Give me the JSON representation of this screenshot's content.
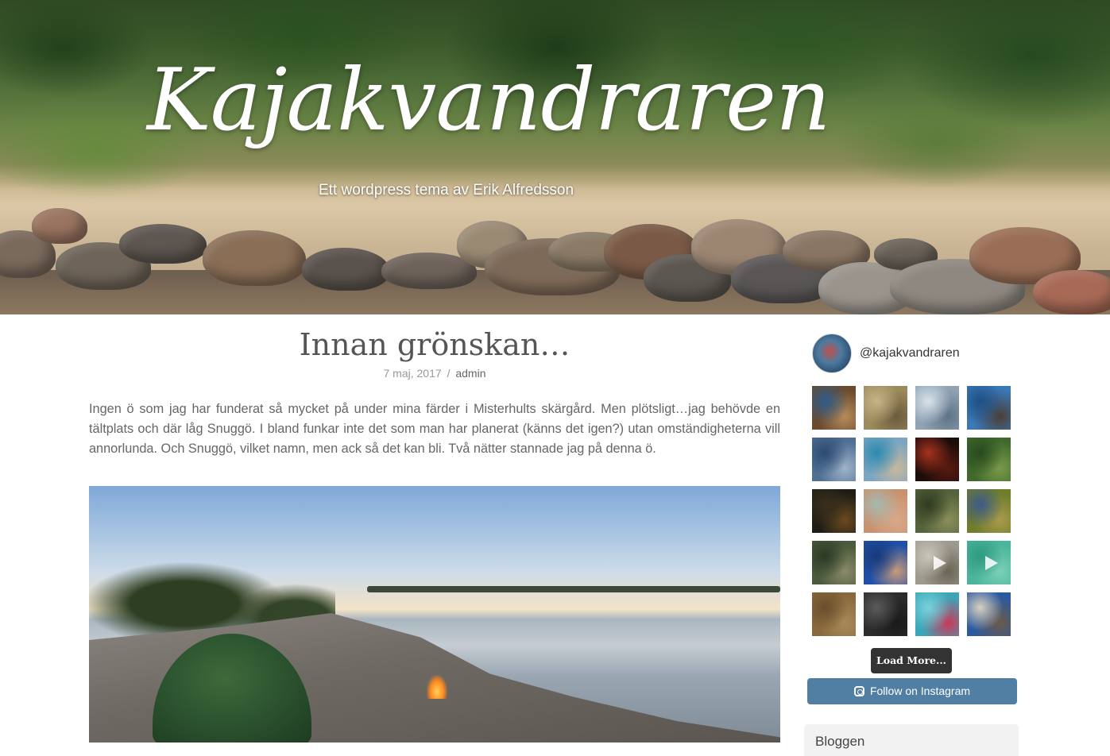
{
  "site": {
    "title": "Kajakvandraren",
    "tagline": "Ett wordpress tema av Erik Alfredsson"
  },
  "post": {
    "title": "Innan grönskan…",
    "date": "7 maj, 2017",
    "separator": "/",
    "author": "admin",
    "body": "Ingen ö som jag har funderat så mycket på under mina färder i Misterhults skärgård. Men plötsligt…jag behövde en tältplats och där låg Snuggö. I bland funkar inte det som man har planerat (känns det igen?) utan omständigheterna vill annorlunda. Och Snuggö, vilket namn, men ack så det kan bli. Två nätter stannade jag på denna ö."
  },
  "instagram": {
    "username": "@kajakvandraren",
    "load_more_label": "Load More...",
    "follow_label": "Follow on Instagram",
    "thumbs": [
      {
        "colors": [
          "#6b4a2e",
          "#2d5c8a",
          "#b58b5a"
        ],
        "video": false
      },
      {
        "colors": [
          "#9c8a5c",
          "#c6b487",
          "#6a5b3c"
        ],
        "video": false
      },
      {
        "colors": [
          "#8fa3b5",
          "#d8e2ea",
          "#5f7386"
        ],
        "video": false
      },
      {
        "colors": [
          "#3a78b8",
          "#1e4f82",
          "#4b3f36"
        ],
        "video": false
      },
      {
        "colors": [
          "#4f6f95",
          "#2d4a70",
          "#9fb3c8"
        ],
        "video": false
      },
      {
        "colors": [
          "#7aa6c2",
          "#2c8ab0",
          "#c9b79b"
        ],
        "video": false
      },
      {
        "colors": [
          "#1a0d0a",
          "#a8321e",
          "#5a1a10"
        ],
        "video": false
      },
      {
        "colors": [
          "#3f6a2c",
          "#2a4a1e",
          "#7a9a4a"
        ],
        "video": false
      },
      {
        "colors": [
          "#1d1d16",
          "#3a2f1c",
          "#6b4a1e"
        ],
        "video": false
      },
      {
        "colors": [
          "#c9926f",
          "#a6b9b0",
          "#d9a98a"
        ],
        "video": false
      },
      {
        "colors": [
          "#54633a",
          "#2f3b22",
          "#8a8f5a"
        ],
        "video": false
      },
      {
        "colors": [
          "#6f7d2c",
          "#3c5a8a",
          "#a89a4a"
        ],
        "video": false
      },
      {
        "colors": [
          "#4a5a3a",
          "#2c3a26",
          "#8a8a6a"
        ],
        "video": false
      },
      {
        "colors": [
          "#1f4fa8",
          "#183a7a",
          "#c89a7a"
        ],
        "video": false
      },
      {
        "colors": [
          "#9e9a8e",
          "#c9c5b8",
          "#6a6456"
        ],
        "video": true
      },
      {
        "colors": [
          "#4ab59a",
          "#2e9a80",
          "#7ad0b8"
        ],
        "video": true
      },
      {
        "colors": [
          "#8a6a3c",
          "#6a4e2c",
          "#a88a5a"
        ],
        "video": false
      },
      {
        "colors": [
          "#2c2c2c",
          "#5a5a5a",
          "#1a1a1a"
        ],
        "video": false
      },
      {
        "colors": [
          "#3aa7b8",
          "#7ad0dc",
          "#c83a5a"
        ],
        "video": false
      },
      {
        "colors": [
          "#2a5aa0",
          "#d8d0c0",
          "#6a5a4a"
        ],
        "video": false
      }
    ]
  },
  "widget": {
    "title": "Bloggen"
  },
  "colors": {
    "follow_button": "#517fa4",
    "load_more_button": "#333333",
    "body_text": "#666666"
  }
}
